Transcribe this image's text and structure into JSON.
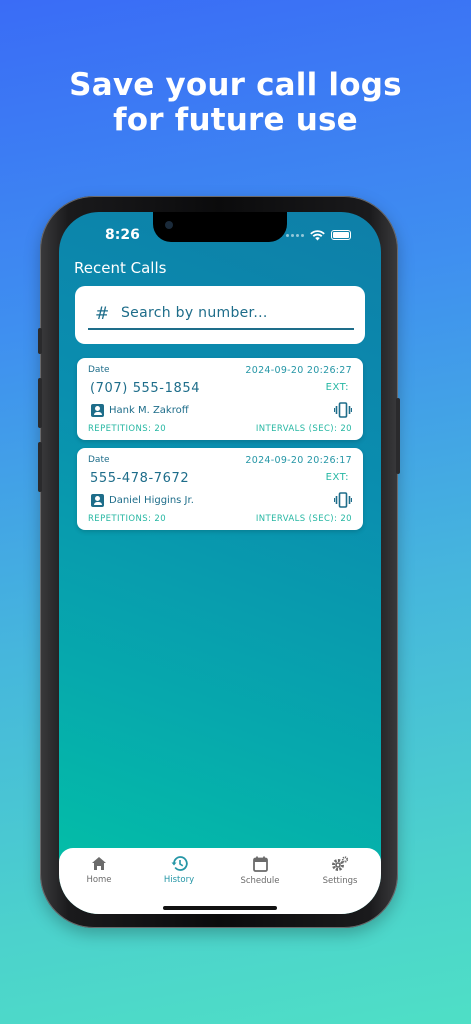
{
  "headline": "Save your call logs\nfor future use",
  "status_bar": {
    "time": "8:26"
  },
  "screen": {
    "title": "Recent Calls",
    "search": {
      "icon": "hash-icon",
      "placeholder": "Search by number..."
    }
  },
  "calls": [
    {
      "date_label": "Date",
      "datetime": "2024-09-20 20:26:27",
      "number": "(707) 555-1854",
      "ext": "EXT:",
      "contact": "Hank M. Zakroff",
      "repetitions": "REPETITIONS: 20",
      "intervals": "INTERVALS (SEC): 20"
    },
    {
      "date_label": "Date",
      "datetime": "2024-09-20 20:26:17",
      "number": "555-478-7672",
      "ext": "EXT:",
      "contact": "Daniel Higgins Jr.",
      "repetitions": "REPETITIONS: 20",
      "intervals": "INTERVALS (SEC): 20"
    }
  ],
  "tabs": [
    {
      "label": "Home",
      "icon": "home-icon"
    },
    {
      "label": "History",
      "icon": "history-icon",
      "active": true
    },
    {
      "label": "Schedule",
      "icon": "calendar-icon"
    },
    {
      "label": "Settings",
      "icon": "gear-icon"
    }
  ],
  "colors": {
    "accent": "#2596a6",
    "primary_text": "#1e6d8a",
    "teal_text": "#26b7a3",
    "tab_inactive": "#6b6b6b"
  }
}
